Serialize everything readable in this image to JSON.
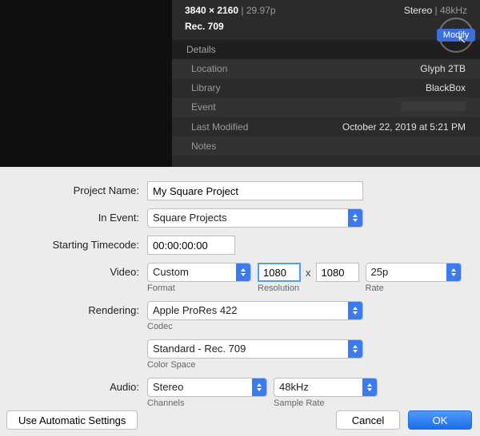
{
  "inspector": {
    "resolution": "3840 × 2160",
    "framerate": "29.97p",
    "audio_summary": "Stereo",
    "audio_rate": "48kHz",
    "color_profile": "Rec. 709",
    "modify_label": "Modify",
    "details_header": "Details",
    "rows": {
      "location": {
        "label": "Location",
        "value": "Glyph 2TB"
      },
      "library": {
        "label": "Library",
        "value": "BlackBox"
      },
      "event": {
        "label": "Event",
        "value": ""
      },
      "modified": {
        "label": "Last Modified",
        "value": "October 22, 2019 at 5:21 PM"
      },
      "notes": {
        "label": "Notes",
        "value": ""
      }
    }
  },
  "dialog": {
    "labels": {
      "project_name": "Project Name:",
      "in_event": "In Event:",
      "starting_tc": "Starting Timecode:",
      "video": "Video:",
      "rendering": "Rendering:",
      "audio": "Audio:"
    },
    "sublabels": {
      "format": "Format",
      "resolution": "Resolution",
      "rate": "Rate",
      "codec": "Codec",
      "color_space": "Color Space",
      "channels": "Channels",
      "sample_rate": "Sample Rate"
    },
    "values": {
      "project_name": "My Square Project",
      "in_event": "Square Projects",
      "starting_tc": "00:00:00:00",
      "format": "Custom",
      "res_w": "1080",
      "res_h": "1080",
      "rate": "25p",
      "codec": "Apple ProRes 422",
      "color_space": "Standard - Rec. 709",
      "channels": "Stereo",
      "sample_rate": "48kHz"
    },
    "buttons": {
      "auto": "Use Automatic Settings",
      "cancel": "Cancel",
      "ok": "OK"
    },
    "x_multiplier": "x"
  }
}
